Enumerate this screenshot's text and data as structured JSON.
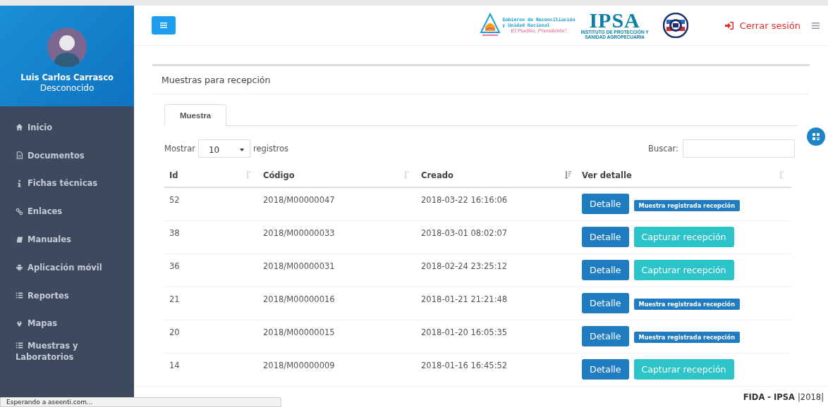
{
  "sidebar": {
    "user": {
      "name": "Luis Carlos Carrasco",
      "role": "Desconocido"
    },
    "items": [
      {
        "label": "Inicio",
        "kind": "home"
      },
      {
        "label": "Documentos",
        "kind": "file"
      },
      {
        "label": "Fichas técnicas",
        "kind": "info"
      },
      {
        "label": "Enlaces",
        "kind": "link"
      },
      {
        "label": "Manuales",
        "kind": "book"
      },
      {
        "label": "Aplicación móvil",
        "kind": "android"
      },
      {
        "label": "Reportes",
        "kind": "list"
      },
      {
        "label": "Mapas",
        "kind": "pin"
      },
      {
        "label": "Muestras y Laboratorios",
        "kind": "list"
      }
    ]
  },
  "header": {
    "logo_gov": {
      "line_1": "Gobierno de Reconciliación",
      "line_2": "y Unidad Nacional",
      "slogan": "El Pueblo, Presidente!"
    },
    "logo_ipsa": {
      "title": "IPSA",
      "subtitle_1": "INSTITUTO DE PROTECCIÓN Y",
      "subtitle_2": "SANIDAD AGROPECUARIA"
    },
    "logout": "Cerrar sesión"
  },
  "panel": {
    "title": "Muestras para recepción",
    "tabs": [
      {
        "label": "Muestra",
        "selected": true
      }
    ],
    "length": {
      "label_before": "Mostrar",
      "value": "10",
      "label_after": "registros"
    },
    "search": {
      "label": "Buscar:"
    },
    "table": {
      "columns": [
        {
          "label": "Id",
          "sorted": false
        },
        {
          "label": "Código",
          "sorted": false
        },
        {
          "label": "Creado",
          "sorted": true
        },
        {
          "label": "Ver detalle",
          "sorted": false
        }
      ],
      "rows": [
        {
          "id": "52",
          "code": "2018/M00000047",
          "created": "2018-03-22 16:16:06",
          "detail": "Detalle",
          "action": {
            "kind": "badge",
            "label": "Muestra registrada recepción"
          }
        },
        {
          "id": "38",
          "code": "2018/M00000033",
          "created": "2018-03-01 08:02:07",
          "detail": "Detalle",
          "action": {
            "kind": "button",
            "label": "Capturar recepción"
          }
        },
        {
          "id": "36",
          "code": "2018/M00000031",
          "created": "2018-02-24 23:25:12",
          "detail": "Detalle",
          "action": {
            "kind": "button",
            "label": "Capturar recepción"
          }
        },
        {
          "id": "21",
          "code": "2018/M00000016",
          "created": "2018-01-21 21:21:48",
          "detail": "Detalle",
          "action": {
            "kind": "badge",
            "label": "Muestra registrada recepción"
          }
        },
        {
          "id": "20",
          "code": "2018/M00000015",
          "created": "2018-01-20 16:05:35",
          "detail": "Detalle",
          "action": {
            "kind": "badge",
            "label": "Muestra registrada recepción"
          }
        },
        {
          "id": "14",
          "code": "2018/M00000009",
          "created": "2018-01-16 16:45:52",
          "detail": "Detalle",
          "action": {
            "kind": "button",
            "label": "Capturar recepción"
          }
        }
      ]
    }
  },
  "footer": {
    "brand": "FIDA - IPSA",
    "year": "|2018|"
  },
  "browser_status": "Esperando a aseenti.com..."
}
